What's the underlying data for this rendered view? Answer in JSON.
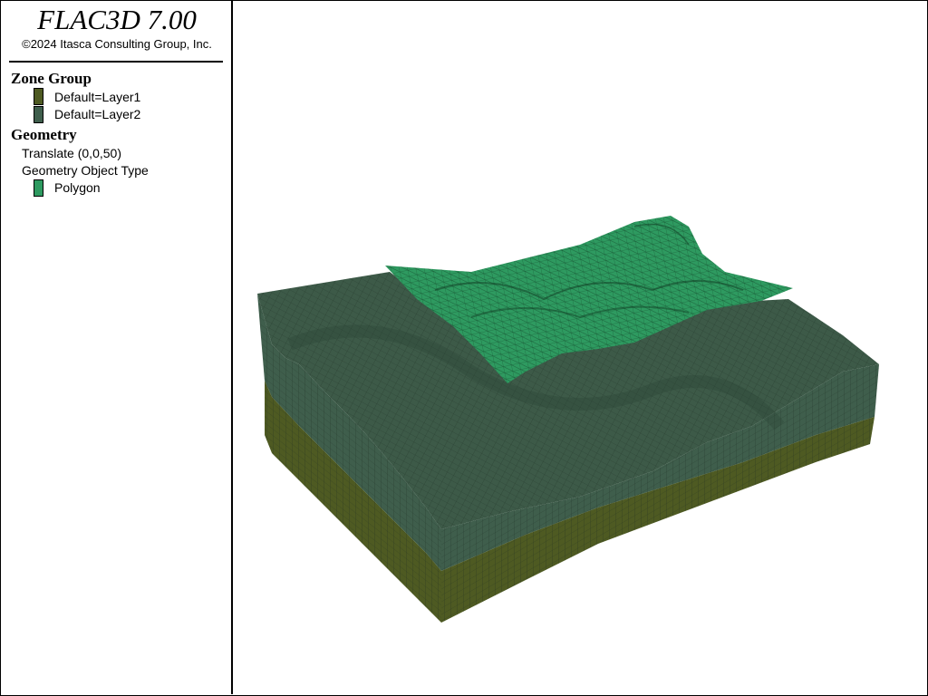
{
  "app": {
    "title": "FLAC3D 7.00",
    "copyright": "©2024 Itasca Consulting Group, Inc."
  },
  "legend": {
    "zone_group": {
      "title": "Zone Group",
      "items": [
        {
          "label": "Default=Layer1",
          "color": "#4e5a22"
        },
        {
          "label": "Default=Layer2",
          "color": "#3f5e4c"
        }
      ]
    },
    "geometry": {
      "title": "Geometry",
      "translate": "Translate (0,0,50)",
      "object_type_label": "Geometry Object Type",
      "items": [
        {
          "label": "Polygon",
          "color": "#2e9a60"
        }
      ]
    }
  },
  "colors": {
    "layer1": "#4e5a22",
    "layer2": "#3f5e4c",
    "polygon": "#2e9a60",
    "mesh_line": "#1a2a1f"
  }
}
